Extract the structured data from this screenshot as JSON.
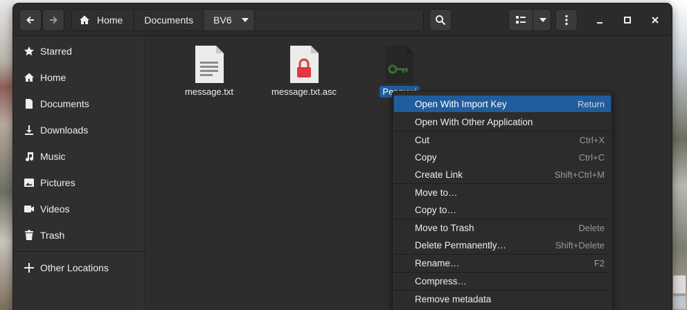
{
  "window": {
    "path": {
      "home_label": "Home",
      "segments": [
        "Documents",
        "BV6"
      ]
    }
  },
  "sidebar": {
    "items": [
      {
        "label": "Starred",
        "icon": "star-icon"
      },
      {
        "label": "Home",
        "icon": "home-icon"
      },
      {
        "label": "Documents",
        "icon": "document-icon"
      },
      {
        "label": "Downloads",
        "icon": "download-icon"
      },
      {
        "label": "Music",
        "icon": "music-icon"
      },
      {
        "label": "Pictures",
        "icon": "picture-icon"
      },
      {
        "label": "Videos",
        "icon": "video-icon"
      },
      {
        "label": "Trash",
        "icon": "trash-icon"
      }
    ],
    "other_locations": "Other Locations"
  },
  "files": [
    {
      "name": "message.txt",
      "icon": "text-file-icon"
    },
    {
      "name": "message.txt.asc",
      "icon": "locked-file-icon"
    },
    {
      "name": "Pennywi",
      "icon": "key-file-icon",
      "selected": true
    }
  ],
  "context_menu": {
    "items": [
      {
        "label": "Open With Import Key",
        "shortcut": "Return",
        "highlighted": true
      },
      {
        "label": "Open With Other Application",
        "shortcut": ""
      },
      {
        "label": "Cut",
        "shortcut": "Ctrl+X"
      },
      {
        "label": "Copy",
        "shortcut": "Ctrl+C"
      },
      {
        "label": "Create Link",
        "shortcut": "Shift+Ctrl+M"
      },
      {
        "label": "Move to…",
        "shortcut": ""
      },
      {
        "label": "Copy to…",
        "shortcut": ""
      },
      {
        "label": "Move to Trash",
        "shortcut": "Delete"
      },
      {
        "label": "Delete Permanently…",
        "shortcut": "Shift+Delete"
      },
      {
        "label": "Rename…",
        "shortcut": "F2"
      },
      {
        "label": "Compress…",
        "shortcut": ""
      },
      {
        "label": "Remove metadata",
        "shortcut": ""
      }
    ]
  },
  "colors": {
    "accent": "#215d9c",
    "lock_red": "#e0383e",
    "key_green": "#3a6e3a"
  }
}
